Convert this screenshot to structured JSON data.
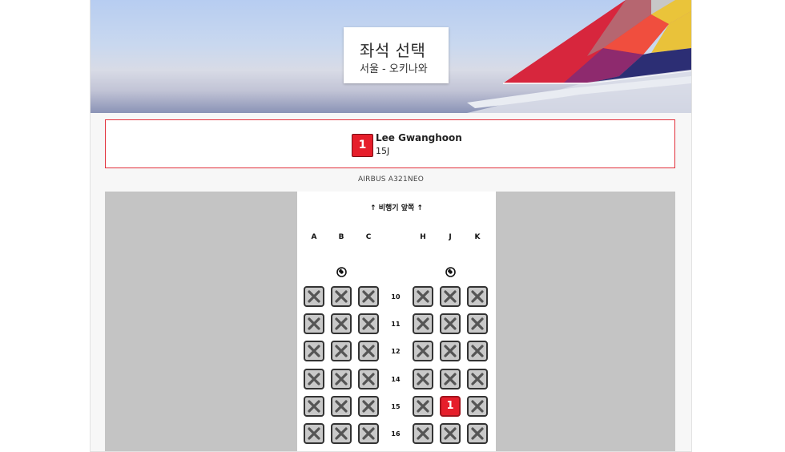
{
  "header": {
    "title": "좌석 선택",
    "route": "서울 - 오키나와"
  },
  "passenger": {
    "number": "1",
    "name": "Lee Gwanghoon",
    "seat": "15J"
  },
  "aircraft": "AIRBUS A321NEO",
  "cabin": {
    "front_label": "↑  비행기 앞쪽  ↑",
    "columns_left": [
      "A",
      "B",
      "C"
    ],
    "columns_right": [
      "H",
      "J",
      "K"
    ],
    "exit_icon": "exit-row-icon",
    "rows": [
      {
        "number": "10",
        "seats": [
          "unavailable",
          "unavailable",
          "unavailable",
          "unavailable",
          "unavailable",
          "unavailable"
        ]
      },
      {
        "number": "11",
        "seats": [
          "unavailable",
          "unavailable",
          "unavailable",
          "unavailable",
          "unavailable",
          "unavailable"
        ]
      },
      {
        "number": "12",
        "seats": [
          "unavailable",
          "unavailable",
          "unavailable",
          "unavailable",
          "unavailable",
          "unavailable"
        ]
      },
      {
        "number": "14",
        "seats": [
          "unavailable",
          "unavailable",
          "unavailable",
          "unavailable",
          "unavailable",
          "unavailable"
        ]
      },
      {
        "number": "15",
        "seats": [
          "unavailable",
          "unavailable",
          "unavailable",
          "unavailable",
          "selected",
          "unavailable"
        ],
        "selected_label": "1"
      },
      {
        "number": "16",
        "seats": [
          "unavailable",
          "unavailable",
          "unavailable",
          "unavailable",
          "unavailable",
          "unavailable"
        ]
      }
    ]
  },
  "colors": {
    "accent_red": "#e61e2b",
    "seat_unavailable": "#c9c9c9",
    "map_background": "#c4c4c4"
  }
}
